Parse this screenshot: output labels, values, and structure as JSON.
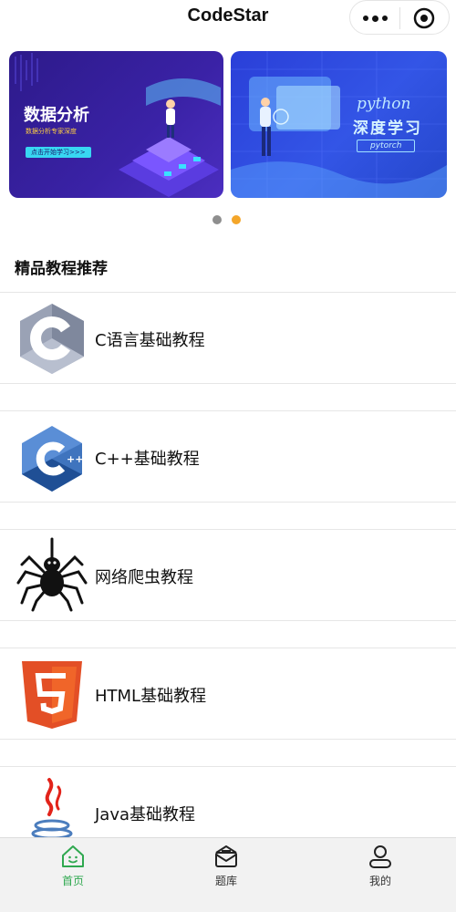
{
  "header": {
    "title": "CodeStar"
  },
  "banner": {
    "slides": [
      {
        "title": "数据分析",
        "subtitle": "数据分析专家深度",
        "button": "点击开始学习>>>"
      },
      {
        "title_line1": "python",
        "title_line2": "深度学习",
        "button": "pytorch"
      }
    ],
    "active_index": 1
  },
  "section": {
    "title": "精品教程推荐"
  },
  "courses": [
    {
      "label": "C语言基础教程",
      "icon": "c-language-icon"
    },
    {
      "label": "C++基础教程",
      "icon": "cpp-icon"
    },
    {
      "label": "网络爬虫教程",
      "icon": "spider-icon"
    },
    {
      "label": "HTML基础教程",
      "icon": "html5-icon"
    },
    {
      "label": "Java基础教程",
      "icon": "java-icon"
    }
  ],
  "tabbar": {
    "items": [
      {
        "label": "首页",
        "icon": "home-icon",
        "active": true
      },
      {
        "label": "题库",
        "icon": "question-bank-icon",
        "active": false
      },
      {
        "label": "我的",
        "icon": "profile-icon",
        "active": false
      }
    ],
    "active_color": "#2fa84f"
  },
  "colors": {
    "dot_inactive": "#8e8e8e",
    "dot_active": "#f4a62a"
  }
}
